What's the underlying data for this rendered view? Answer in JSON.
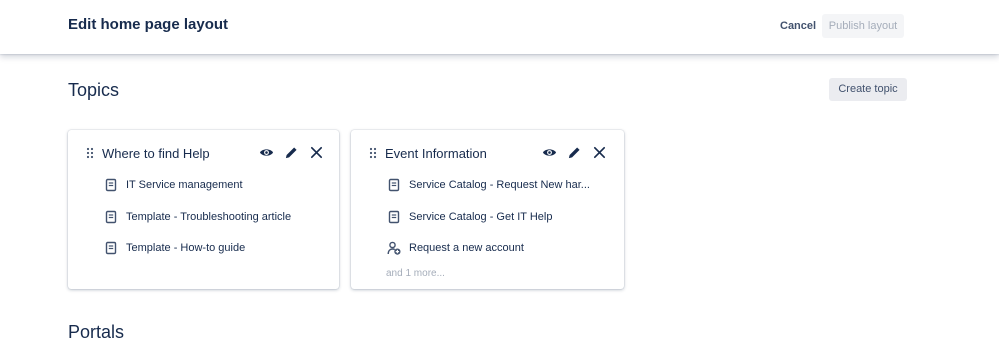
{
  "header": {
    "title": "Edit home page layout",
    "cancel_label": "Cancel",
    "publish_label": "Publish layout"
  },
  "topics": {
    "title": "Topics",
    "create_label": "Create topic",
    "cards": [
      {
        "title": "Where to find Help",
        "items": [
          {
            "label": "IT Service management",
            "icon": "article-icon"
          },
          {
            "label": "Template - Troubleshooting article",
            "icon": "article-icon"
          },
          {
            "label": "Template - How-to guide",
            "icon": "article-icon"
          }
        ]
      },
      {
        "title": "Event Information",
        "items": [
          {
            "label": "Service Catalog - Request New har...",
            "icon": "article-icon"
          },
          {
            "label": "Service Catalog - Get IT Help",
            "icon": "article-icon"
          },
          {
            "label": "Request a new account",
            "icon": "add-person-icon"
          }
        ],
        "more": "and 1 more..."
      }
    ]
  },
  "portals": {
    "title": "Portals"
  },
  "colors": {
    "text": "#172b4d",
    "muted": "#a5adba",
    "button_bg": "#ebecf0"
  }
}
